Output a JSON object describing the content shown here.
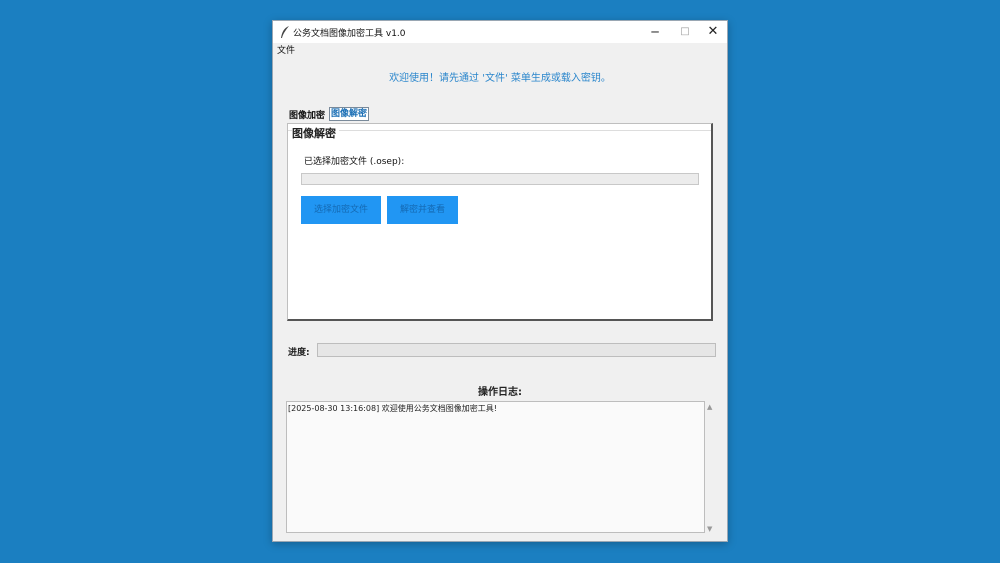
{
  "window": {
    "title": "公务文档图像加密工具 v1.0",
    "controls": {
      "minimize": "─",
      "maximize": "□",
      "close": "✕"
    }
  },
  "menu": {
    "file": "文件"
  },
  "welcome": "欢迎使用！请先通过 '文件' 菜单生成或载入密钥。",
  "tabs": [
    {
      "label": "图像加密",
      "selected": false
    },
    {
      "label": "图像解密",
      "selected": true
    }
  ],
  "decrypt_panel": {
    "title": "图像解密",
    "selected_file_label": "已选择加密文件 (.osep):",
    "selected_file_value": "",
    "buttons": {
      "select": "选择加密文件",
      "decrypt": "解密并查看"
    }
  },
  "progress": {
    "label": "进度:",
    "value": 0
  },
  "log": {
    "label": "操作日志:",
    "entries": [
      "[2025-08-30 13:16:08] 欢迎使用公务文档图像加密工具!"
    ]
  },
  "colors": {
    "desktop": "#1b7fc1",
    "accent": "#2196f3",
    "welcome_text": "#2a86cc"
  },
  "icons": {
    "app": "feather-icon",
    "scroll_up": "arrow-up-icon",
    "scroll_down": "arrow-down-icon"
  }
}
